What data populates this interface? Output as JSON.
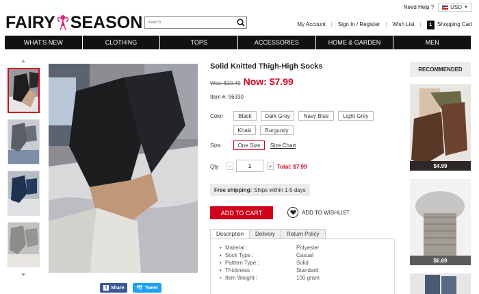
{
  "header": {
    "logo_left": "FAIRY",
    "logo_right": "SEASON",
    "help": "Need Help ?",
    "currency": "USD",
    "search_placeholder": "Search",
    "my_account": "My Account",
    "sign_in": "Sign In / Register",
    "wish_list": "Wish List",
    "cart_count": "1",
    "shopping_cart": "Shopping Cart"
  },
  "nav": [
    "WHAT'S NEW",
    "CLOTHING",
    "TOPS",
    "ACCESSORIES",
    "HOME & GARDEN",
    "MEN"
  ],
  "product": {
    "title": "Solid Knitted Thigh-High Socks",
    "was": "Was: $10.49",
    "now": "Now: $7.99",
    "item_label": "Item #:",
    "item_no": "96330",
    "color_label": "Color",
    "colors": [
      "Black",
      "Dark Grey",
      "Navy Blue",
      "Light Grey",
      "Khaki",
      "Burgundy"
    ],
    "size_label": "Size",
    "size": "One Size",
    "size_chart": "Size Chart",
    "qty_label": "Qty",
    "qty_minus": "-",
    "qty_plus": "+",
    "qty": "1",
    "total_label": "Total:",
    "total": "$7.99",
    "shipping_bold": "Free shipping:",
    "shipping_text": "Ships within 1-5 days",
    "add_to_cart": "ADD TO CART",
    "add_to_wishlist": "ADD TO WISHLIST"
  },
  "share": {
    "facebook": "Share",
    "twitter": "Tweet"
  },
  "tabs": [
    "Description",
    "Delivery",
    "Return Policy"
  ],
  "specs": [
    {
      "k": "Material :",
      "v": "Polyester"
    },
    {
      "k": "Sock Type :",
      "v": "Casual"
    },
    {
      "k": "Pattern Type :",
      "v": "Solid"
    },
    {
      "k": "Thickness :",
      "v": "Standard"
    },
    {
      "k": "Item Weight :",
      "v": "100 gram"
    }
  ],
  "recommended": {
    "title": "RECOMMENDED",
    "items": [
      {
        "price": "$4.99"
      },
      {
        "price": "$6.69"
      }
    ]
  },
  "colors": {
    "accent": "#d0021b",
    "nav_bg": "#111111",
    "facebook": "#3b5998",
    "twitter": "#1da1f2"
  }
}
